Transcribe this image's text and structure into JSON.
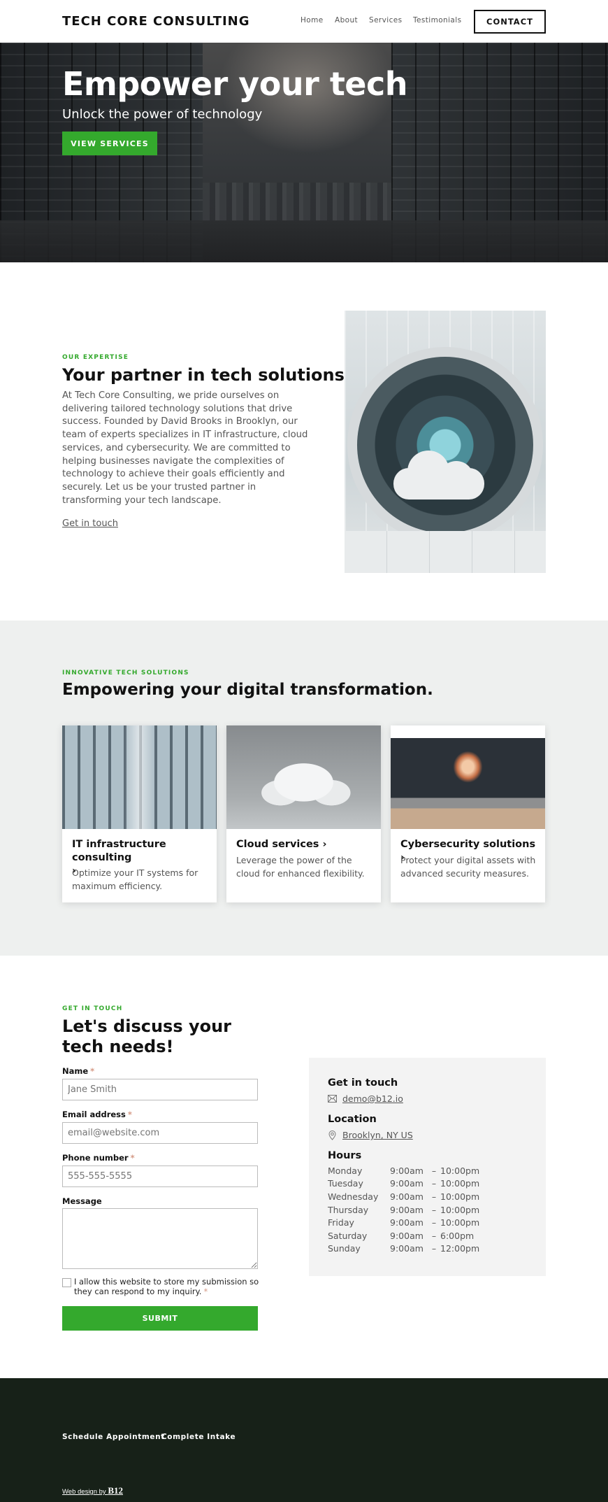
{
  "header": {
    "brand": "TECH CORE CONSULTING",
    "nav": [
      "Home",
      "About",
      "Services",
      "Testimonials"
    ],
    "cta": "CONTACT"
  },
  "hero": {
    "title": "Empower your tech",
    "subtitle": "Unlock the power of technology",
    "button": "VIEW SERVICES"
  },
  "about": {
    "eyebrow": "OUR EXPERTISE",
    "title": "Your partner in tech solutions",
    "body": "At Tech Core Consulting, we pride ourselves on delivering tailored technology solutions that drive success. Founded by David Brooks in Brooklyn, our team of experts specializes in IT infrastructure, cloud services, and cybersecurity. We are committed to helping businesses navigate the complexities of technology to achieve their goals efficiently and securely. Let us be your trusted partner in transforming your tech landscape.",
    "link": "Get in touch",
    "image": "cloud-datacenter-illustration"
  },
  "services": {
    "eyebrow": "INNOVATIVE TECH SOLUTIONS",
    "title": "Empowering your digital transformation.",
    "cards": [
      {
        "title": "IT infrastructure consulting",
        "arrow": "›",
        "desc": "Optimize your IT systems for maximum efficiency.",
        "image": "glass-server-hallway"
      },
      {
        "title": "Cloud services",
        "arrow": "›",
        "desc": "Leverage the power of the cloud for enhanced flexibility.",
        "image": "white-cloud-sculpture"
      },
      {
        "title": "Cybersecurity solutions",
        "arrow": "›",
        "desc": "Protect your digital assets with advanced security measures.",
        "image": "laptop-security-glow"
      }
    ]
  },
  "contact": {
    "eyebrow": "GET IN TOUCH",
    "title": "Let's discuss your tech needs!",
    "form": {
      "name_label": "Name",
      "name_placeholder": "Jane Smith",
      "email_label": "Email address",
      "email_placeholder": "email@website.com",
      "phone_label": "Phone number",
      "phone_placeholder": "555-555-5555",
      "message_label": "Message",
      "message_placeholder": "",
      "required_mark": "*",
      "consent": "I allow this website to store my submission so they can respond to my inquiry.",
      "submit": "SUBMIT"
    },
    "info": {
      "touch_heading": "Get in touch",
      "email": "demo@b12.io",
      "location_heading": "Location",
      "location": "Brooklyn, NY US",
      "hours_heading": "Hours",
      "hours": [
        {
          "day": "Monday",
          "open": "9:00am",
          "close": "10:00pm"
        },
        {
          "day": "Tuesday",
          "open": "9:00am",
          "close": "10:00pm"
        },
        {
          "day": "Wednesday",
          "open": "9:00am",
          "close": "10:00pm"
        },
        {
          "day": "Thursday",
          "open": "9:00am",
          "close": "10:00pm"
        },
        {
          "day": "Friday",
          "open": "9:00am",
          "close": "10:00pm"
        },
        {
          "day": "Saturday",
          "open": "9:00am",
          "close": "6:00pm"
        },
        {
          "day": "Sunday",
          "open": "9:00am",
          "close": "12:00pm"
        }
      ],
      "dash": "–"
    }
  },
  "footer": {
    "links": [
      "Schedule Appointment",
      "Complete Intake"
    ],
    "credit_prefix": "Web design by ",
    "credit_brand": "B12"
  },
  "colors": {
    "accent": "#34a92d",
    "services_bg": "#eef0ef",
    "info_bg": "#f3f3f3",
    "footer_bg": "#172118"
  }
}
